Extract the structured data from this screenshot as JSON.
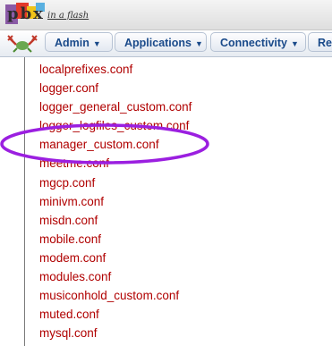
{
  "logo": {
    "letters": "pbx",
    "tagline": "in a flash"
  },
  "menu": {
    "items": [
      {
        "label": "Admin"
      },
      {
        "label": "Applications"
      },
      {
        "label": "Connectivity"
      },
      {
        "label": "Rep"
      }
    ],
    "caret": "▼"
  },
  "files": [
    "localprefixes.conf",
    "logger.conf",
    "logger_general_custom.conf",
    "logger_logfiles_custom.conf",
    "manager_custom.conf",
    "meetme.conf",
    "mgcp.conf",
    "minivm.conf",
    "misdn.conf",
    "mobile.conf",
    "modem.conf",
    "modules.conf",
    "musiconhold_custom.conf",
    "muted.conf",
    "mysql.conf"
  ],
  "colors": {
    "file_link": "#b00000",
    "highlight_ellipse": "#9b1fe0",
    "menu_text": "#1a4a8a"
  },
  "icons": [
    "app-logo-icon",
    "crab-icon",
    "chevron-down-icon"
  ],
  "highlighted_file": "manager_custom.conf"
}
